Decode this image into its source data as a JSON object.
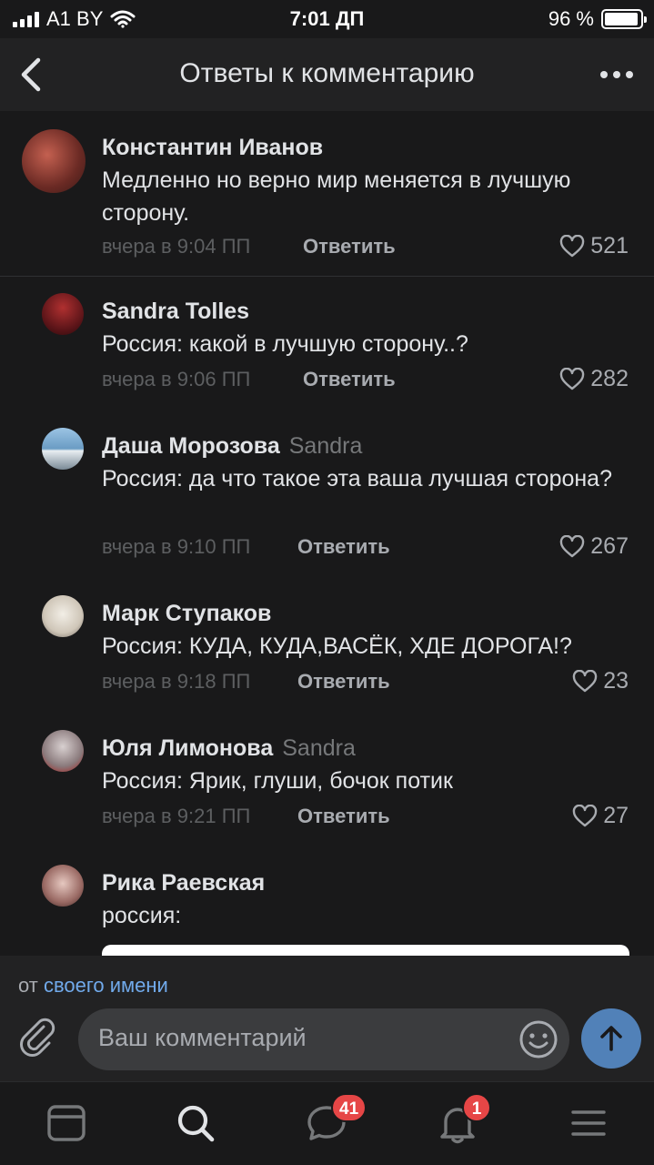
{
  "status_bar": {
    "carrier": "A1 BY",
    "time": "7:01 ДП",
    "battery": "96 %",
    "battery_level": 0.96
  },
  "header": {
    "title": "Ответы к комментарию"
  },
  "comments": [
    {
      "author": "Константин Иванов",
      "reply_to": "",
      "text": "Медленно но верно мир меняется в лучшую сторону.",
      "time": "вчера в 9:04 ПП",
      "reply_label": "Ответить",
      "likes": "521"
    },
    {
      "author": "Sandra Tolles",
      "reply_to": "",
      "text": "Россия: какой в лучшую сторону..?",
      "time": "вчера в 9:06 ПП",
      "reply_label": "Ответить",
      "likes": "282"
    },
    {
      "author": "Даша Морозова",
      "reply_to": "Sandra",
      "text": "Россия: да что такое эта ваша лучшая сторона?",
      "time": "вчера в 9:10 ПП",
      "reply_label": "Ответить",
      "likes": "267"
    },
    {
      "author": "Марк Ступаков",
      "reply_to": "",
      "text": "Россия: КУДА, КУДА,ВАСЁК, ХДЕ ДОРОГА!?",
      "time": "вчера в 9:18 ПП",
      "reply_label": "Ответить",
      "likes": "23"
    },
    {
      "author": "Юля Лимонова",
      "reply_to": "Sandra",
      "text": "Россия: Ярик, глуши, бочок потик",
      "time": "вчера в 9:21 ПП",
      "reply_label": "Ответить",
      "likes": "27"
    },
    {
      "author": "Рика Раевская",
      "reply_to": "",
      "text": "россия:"
    }
  ],
  "composer": {
    "from_prefix": "от",
    "from_link": "своего имени",
    "placeholder": "Ваш комментарий"
  },
  "tabbar": {
    "messages_badge": "41",
    "notifications_badge": "1"
  },
  "colors": {
    "background": "#19191a",
    "header": "#222223",
    "accent": "#5181b8",
    "link": "#71aaeb",
    "badge": "#e64646"
  }
}
